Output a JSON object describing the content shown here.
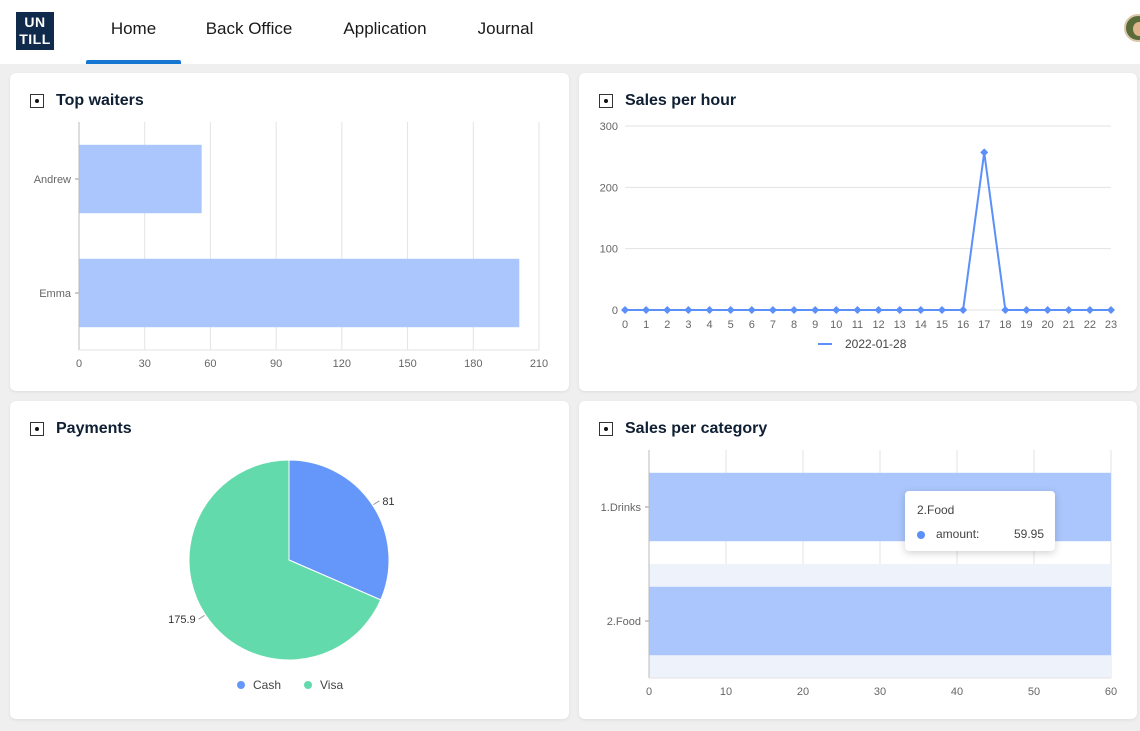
{
  "app": {
    "logo_top": "UN",
    "logo_bottom": "TILL",
    "nav": [
      {
        "label": "Home",
        "active": true
      },
      {
        "label": "Back Office",
        "active": false
      },
      {
        "label": "Application",
        "active": false
      },
      {
        "label": "Journal",
        "active": false
      }
    ]
  },
  "colors": {
    "bar": "#abc6fc",
    "line": "#5b8ff9",
    "pie_cash": "#6597fa",
    "pie_visa": "#62daab",
    "accent": "#1677d2"
  },
  "cards": {
    "top_waiters": {
      "title": "Top waiters"
    },
    "sales_per_hour": {
      "title": "Sales per hour"
    },
    "payments": {
      "title": "Payments"
    },
    "sales_per_category": {
      "title": "Sales per category"
    }
  },
  "chart_data": [
    {
      "id": "top_waiters",
      "type": "bar",
      "orientation": "horizontal",
      "categories": [
        "Andrew",
        "Emma"
      ],
      "values": [
        56,
        201
      ],
      "xlim": [
        0,
        210
      ],
      "xticks": [
        0,
        30,
        60,
        90,
        120,
        150,
        180,
        210
      ],
      "grid": true
    },
    {
      "id": "sales_per_hour",
      "type": "line",
      "x": [
        0,
        1,
        2,
        3,
        4,
        5,
        6,
        7,
        8,
        9,
        10,
        11,
        12,
        13,
        14,
        15,
        16,
        17,
        18,
        19,
        20,
        21,
        22,
        23
      ],
      "series": [
        {
          "name": "2022-01-28",
          "values": [
            0,
            0,
            0,
            0,
            0,
            0,
            0,
            0,
            0,
            0,
            0,
            0,
            0,
            0,
            0,
            0,
            0,
            257,
            0,
            0,
            0,
            0,
            0,
            0
          ]
        }
      ],
      "ylim": [
        0,
        300
      ],
      "yticks": [
        0,
        100,
        200,
        300
      ],
      "grid": true,
      "legend": "bottom"
    },
    {
      "id": "payments",
      "type": "pie",
      "slices": [
        {
          "label": "Cash",
          "value": 81,
          "value_label": "81"
        },
        {
          "label": "Visa",
          "value": 175.9,
          "value_label": "175.9"
        }
      ],
      "legend": "bottom"
    },
    {
      "id": "sales_per_category",
      "type": "bar",
      "orientation": "horizontal",
      "categories": [
        "1.Drinks",
        "2.Food"
      ],
      "values": [
        60,
        60
      ],
      "xlim": [
        0,
        60
      ],
      "xticks": [
        0,
        10,
        20,
        30,
        40,
        50,
        60
      ],
      "grid": true,
      "tooltip": {
        "title": "2.Food",
        "name": "amount:",
        "value": "59.95"
      }
    }
  ]
}
